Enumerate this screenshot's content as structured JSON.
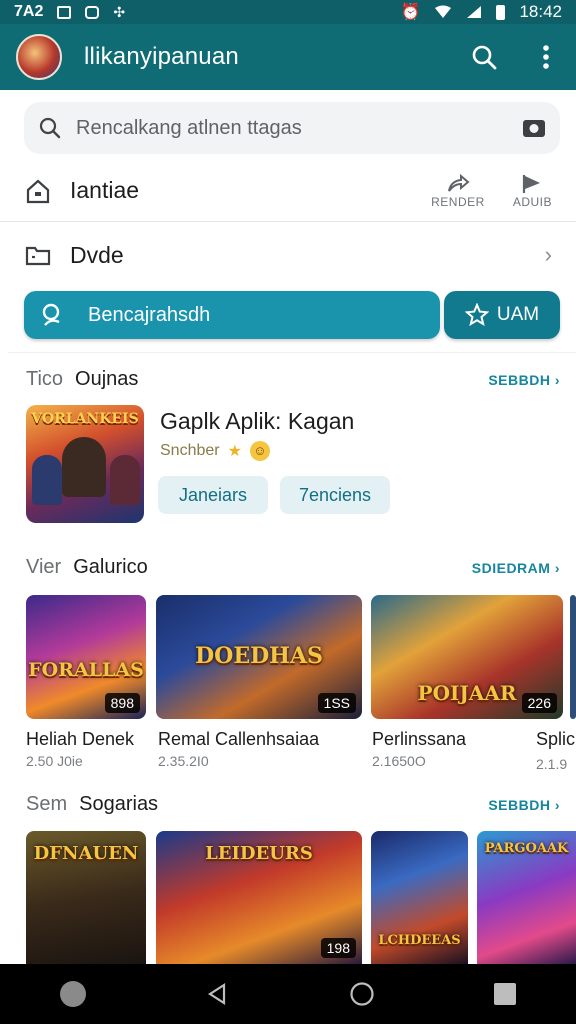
{
  "status_bar": {
    "left_text": "7A2",
    "time": "18:42"
  },
  "app_bar": {
    "title": "llikanyipanuan",
    "icons": [
      "avatar",
      "search-icon",
      "more-vert-icon"
    ]
  },
  "search": {
    "placeholder": "Rencalkang atlnen ttagas"
  },
  "shortcuts": {
    "home_label": "Iantiae",
    "mini_actions": [
      {
        "label": "RENDER",
        "icon": "share-icon"
      },
      {
        "label": "ADUIB",
        "icon": "play-flag-icon"
      }
    ],
    "folder_label": "Dvde"
  },
  "actions": {
    "primary_label": "Bencajrahsdh",
    "secondary_label": "UAM"
  },
  "featured_section": {
    "prefix": "Tico",
    "title": "Oujnas",
    "more": "SEBBDH",
    "app_title": "Gaplk Aplik: Kagan",
    "app_subtitle": "Snchber",
    "chips": [
      "Janeiars",
      "7enciens"
    ],
    "art_text": "VORLANKEIS"
  },
  "games_section": {
    "prefix": "Vier",
    "title": "Galurico",
    "more": "SDIEDRAM",
    "cards": [
      {
        "title": "Heliah Denek",
        "meta": "2.50 J0ie",
        "badge": "898",
        "art_text": "FORALLAS"
      },
      {
        "title": "Remal Callenhsaiaa",
        "meta": "2.35.2I0",
        "badge": "1SS",
        "art_text": "DOEDHAS"
      },
      {
        "title": "Perlinssana",
        "meta": "2.1650O",
        "badge": "226",
        "art_text": "POIJAAR"
      },
      {
        "title": "Splic",
        "meta": "2.1.9",
        "badge": "",
        "art_text": ""
      }
    ]
  },
  "more_section": {
    "prefix": "Sem",
    "title": "Sogarias",
    "more": "SEBBDH",
    "cards": [
      {
        "art_text": "DFNAUEN",
        "badge": ""
      },
      {
        "art_text": "LEIDEURS",
        "badge": "198"
      },
      {
        "art_text": "LCHDEEAS",
        "badge": ""
      },
      {
        "art_text": "PARGOAAK",
        "badge": ""
      }
    ]
  },
  "colors": {
    "app_bar": "#0f6b74",
    "accent": "#1a93ad",
    "link": "#16869c"
  }
}
